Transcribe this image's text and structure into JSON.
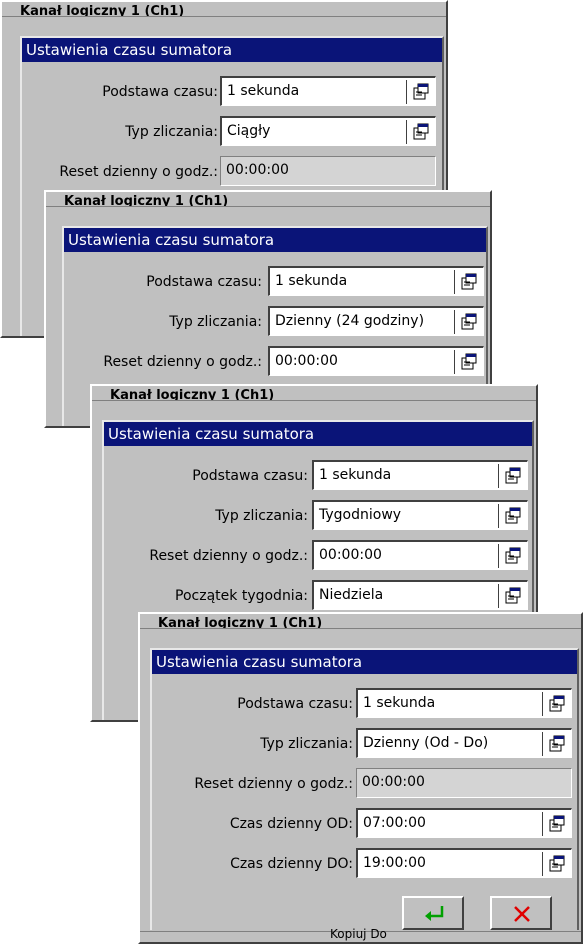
{
  "panels": [
    {
      "channel_header": "Kanał logiczny 1 (Ch1)",
      "title": "Ustawienia czasu sumatora",
      "rows": [
        {
          "label": "Podstawa czasu:",
          "value": "1 sekunda",
          "picker": true
        },
        {
          "label": "Typ zliczania:",
          "value": "Ciągły",
          "picker": true
        },
        {
          "label": "Reset dzienny o godz.:",
          "value": "00:00:00",
          "disabled": true
        }
      ]
    },
    {
      "channel_header": "Kanał logiczny 1 (Ch1)",
      "title": "Ustawienia czasu sumatora",
      "rows": [
        {
          "label": "Podstawa czasu:",
          "value": "1 sekunda",
          "picker": true
        },
        {
          "label": "Typ zliczania:",
          "value": "Dzienny (24 godziny)",
          "picker": true
        },
        {
          "label": "Reset dzienny o godz.:",
          "value": "00:00:00",
          "picker": true
        }
      ]
    },
    {
      "channel_header": "Kanał logiczny 1 (Ch1)",
      "title": "Ustawienia czasu sumatora",
      "rows": [
        {
          "label": "Podstawa czasu:",
          "value": "1 sekunda",
          "picker": true
        },
        {
          "label": "Typ zliczania:",
          "value": "Tygodniowy",
          "picker": true
        },
        {
          "label": "Reset dzienny o godz.:",
          "value": "00:00:00",
          "picker": true
        },
        {
          "label": "Początek tygodnia:",
          "value": "Niedziela",
          "picker": true
        }
      ]
    },
    {
      "channel_header": "Kanał logiczny 1 (Ch1)",
      "title": "Ustawienia czasu sumatora",
      "rows": [
        {
          "label": "Podstawa czasu:",
          "value": "1 sekunda",
          "picker": true
        },
        {
          "label": "Typ zliczania:",
          "value": "Dzienny (Od - Do)",
          "picker": true
        },
        {
          "label": "Reset dzienny o godz.:",
          "value": "00:00:00",
          "disabled": true
        },
        {
          "label": "Czas dzienny OD:",
          "value": "07:00:00",
          "picker": true
        },
        {
          "label": "Czas dzienny DO:",
          "value": "19:00:00",
          "picker": true
        }
      ],
      "buttons": {
        "ok_icon": "enter-icon",
        "cancel_icon": "close-icon"
      },
      "footer_button_label": "Kopiuj Do"
    }
  ],
  "colors": {
    "titlebar": "#0a1478",
    "ok_icon": "#00a000",
    "cancel_icon": "#e00000"
  }
}
